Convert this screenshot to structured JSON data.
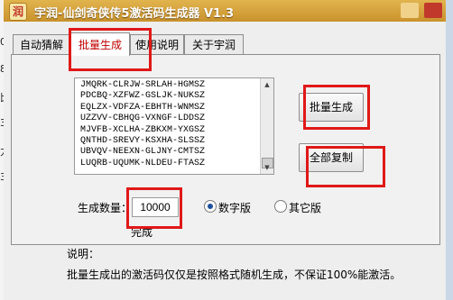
{
  "window": {
    "title": "宇润-仙剑奇侠传5激活码生成器 V1.3",
    "app_icon_glyph": "润"
  },
  "background": {
    "left_glyphs": [
      "0",
      "8",
      "比",
      "3",
      "力",
      "3"
    ]
  },
  "tabs": [
    {
      "label": "自动猜解",
      "active": false
    },
    {
      "label": "批量生成",
      "active": true
    },
    {
      "label": "使用说明",
      "active": false
    },
    {
      "label": "关于宇润",
      "active": false
    }
  ],
  "codes": [
    "JMQRK-CLRJW-SRLAH-HGMSZ",
    "PDCBQ-XZFWZ-GSLJK-NUKSZ",
    "EQLZX-VDFZA-EBHTH-WNMSZ",
    "UZZVV-CBHQG-VXNGF-LDDSZ",
    "MJVFB-XCLHA-ZBKXM-YXGSZ",
    "QNTHD-SREVY-KSXHA-SLSSZ",
    "UBVQV-NEEXN-GLJNY-CMTSZ",
    "LUQRB-UQUMK-NLDEU-FTASZ"
  ],
  "buttons": {
    "generate": "批量生成",
    "copy_all": "全部复制"
  },
  "count": {
    "label": "生成数量：",
    "value": "10000"
  },
  "status": "完成",
  "radios": [
    {
      "label": "数字版",
      "selected": true
    },
    {
      "label": "其它版",
      "selected": false
    }
  ],
  "notes": {
    "heading": "说明：",
    "text": "批量生成出的激活码仅仅是按照格式随机生成，不保证100%能激活。"
  },
  "colors": {
    "titlebar": "#d4a43c",
    "active_tab_text": "#c00000",
    "highlight": "#e01818",
    "radio_dot": "#1e4f9c"
  }
}
